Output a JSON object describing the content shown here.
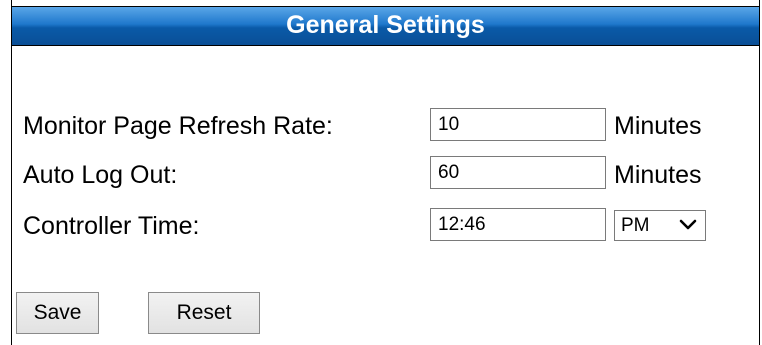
{
  "header": {
    "title": "General Settings"
  },
  "settings": {
    "refresh_rate": {
      "label": "Monitor Page Refresh Rate:",
      "value": "10",
      "unit": "Minutes"
    },
    "auto_logout": {
      "label": "Auto Log Out:",
      "value": "60",
      "unit": "Minutes"
    },
    "controller_time": {
      "label": "Controller Time:",
      "value": "12:46",
      "ampm": "PM",
      "chevron_icon": "chevron-down-icon"
    }
  },
  "buttons": {
    "save": "Save",
    "reset": "Reset"
  },
  "colors": {
    "header_gradient_top": "#5aa6e8",
    "header_gradient_bottom": "#0a4f96",
    "header_text": "#ffffff"
  }
}
